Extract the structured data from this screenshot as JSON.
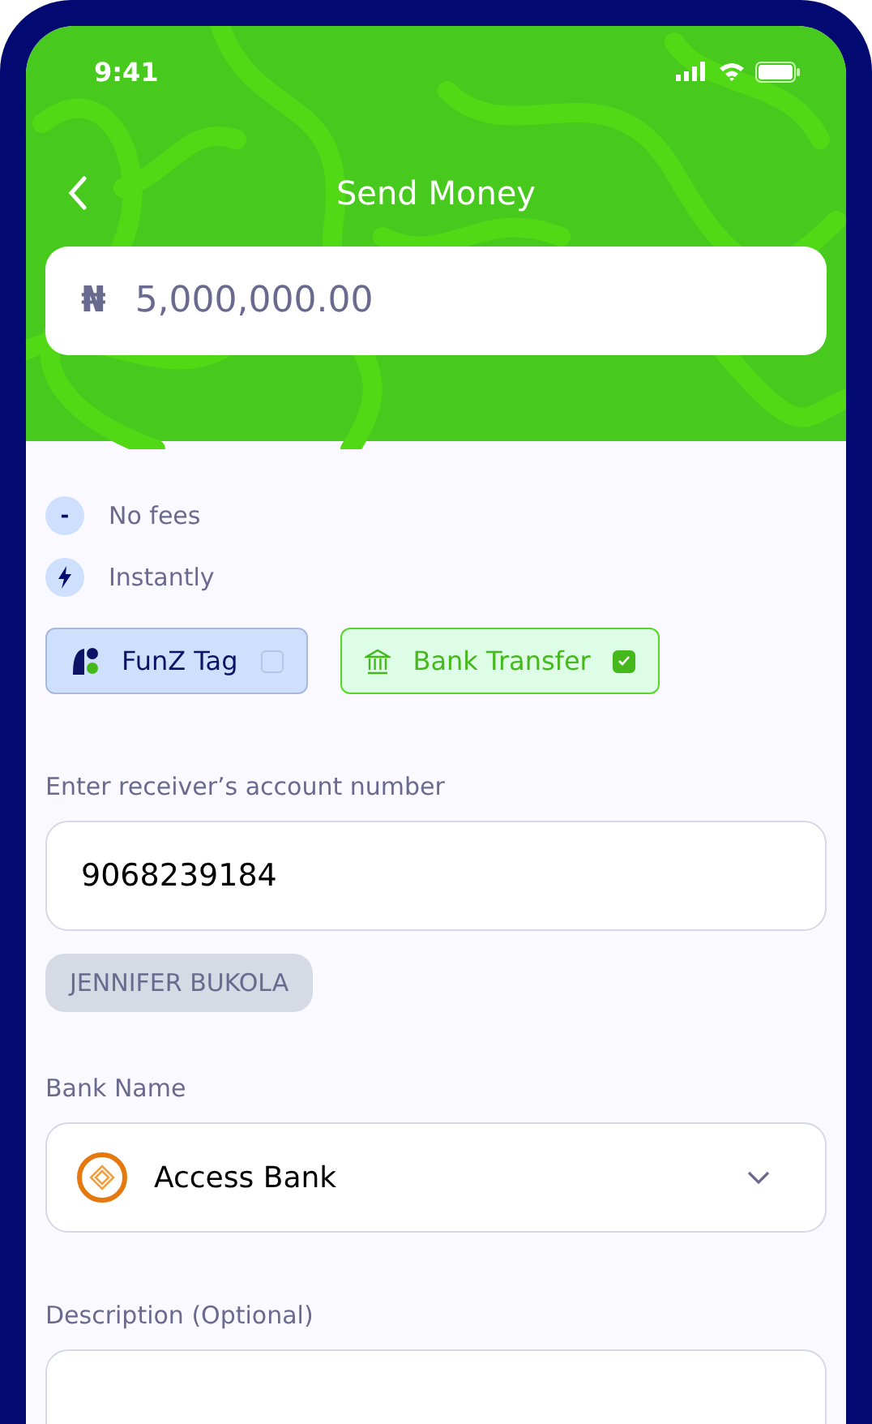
{
  "status_bar": {
    "time": "9:41"
  },
  "header": {
    "title": "Send Money"
  },
  "amount": {
    "currency": "₦",
    "value": "5,000,000.00"
  },
  "features": [
    {
      "kind": "symbol",
      "symbol": "-",
      "label": "No fees"
    },
    {
      "kind": "bolt",
      "label": "Instantly"
    }
  ],
  "methods": [
    {
      "kind": "tag",
      "label": "FunZ Tag",
      "selected": false
    },
    {
      "kind": "bank",
      "label": "Bank Transfer",
      "selected": true
    }
  ],
  "account": {
    "label": "Enter receiver’s account number",
    "value": "9068239184",
    "account_name": "JENNIFER BUKOLA"
  },
  "bank": {
    "label": "Bank Name",
    "value": "Access Bank"
  },
  "description": {
    "label": "Description (Optional)"
  }
}
